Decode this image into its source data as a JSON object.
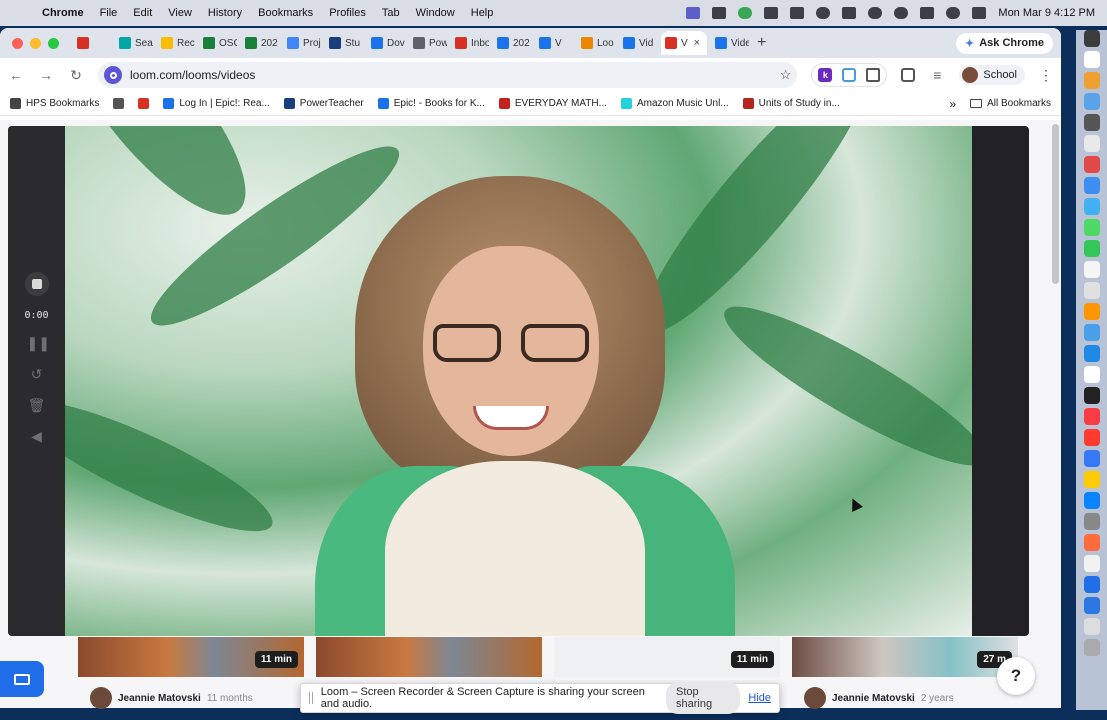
{
  "menubar": {
    "app": "Chrome",
    "menus": [
      "File",
      "Edit",
      "View",
      "History",
      "Bookmarks",
      "Profiles",
      "Tab",
      "Window",
      "Help"
    ],
    "clock": "Mon Mar 9  4:12 PM"
  },
  "tabs": [
    {
      "label": "",
      "color": "#d93025"
    },
    {
      "label": "Sea",
      "color": "#00a6a6"
    },
    {
      "label": "Rec",
      "color": "#fbbc04"
    },
    {
      "label": "OSC",
      "color": "#188038"
    },
    {
      "label": "202",
      "color": "#188038"
    },
    {
      "label": "Proj",
      "color": "#4285f4"
    },
    {
      "label": "Stu",
      "color": "#1a3d7c"
    },
    {
      "label": "Dov",
      "color": "#1a73e8"
    },
    {
      "label": "Pow",
      "color": "#5f6368"
    },
    {
      "label": "Inbo",
      "color": "#d93025"
    },
    {
      "label": "202",
      "color": "#1a73e8"
    },
    {
      "label": "V",
      "color": "#1a73e8"
    },
    {
      "label": "Loo",
      "color": "#ea8600"
    },
    {
      "label": "Vid",
      "color": "#1a73e8"
    },
    {
      "label": "V",
      "color": "#d93025",
      "active": true
    },
    {
      "label": "Vide",
      "color": "#1a73e8"
    }
  ],
  "ask_chrome": "Ask Chrome",
  "url": "loom.com/looms/videos",
  "profile": "School",
  "bookmarks": [
    {
      "label": "HPS Bookmarks",
      "color": "#444444"
    },
    {
      "label": "",
      "color": "#555555"
    },
    {
      "label": "",
      "color": "#d93025"
    },
    {
      "label": "Log In | Epic!: Rea...",
      "color": "#1a73e8"
    },
    {
      "label": "PowerTeacher",
      "color": "#1a3d7c"
    },
    {
      "label": "Epic! - Books for K...",
      "color": "#1a73e8"
    },
    {
      "label": "EVERYDAY MATH...",
      "color": "#c5221f"
    },
    {
      "label": "Amazon Music Unl...",
      "color": "#25d1da"
    },
    {
      "label": "Units of Study in...",
      "color": "#b3261e"
    }
  ],
  "all_bookmarks": "All Bookmarks",
  "recorder": {
    "timer": "0:00"
  },
  "videos": [
    {
      "duration": "11 min",
      "owner": "Jeannie Matovski",
      "age": "11 months"
    },
    {
      "duration": "",
      "owner": "",
      "age": ""
    },
    {
      "duration": "11 min",
      "owner": "",
      "age": ""
    },
    {
      "duration": "27 m",
      "owner": "Jeannie Matovski",
      "age": "2 years"
    }
  ],
  "help": "?",
  "share_bar": {
    "message": "Loom – Screen Recorder & Screen Capture is sharing your screen and audio.",
    "stop": "Stop sharing",
    "hide": "Hide"
  },
  "colors": {
    "loom_purple": "#5d54d8",
    "loom_blue": "#1f6de8",
    "cardigan_green": "#4ab97f"
  }
}
